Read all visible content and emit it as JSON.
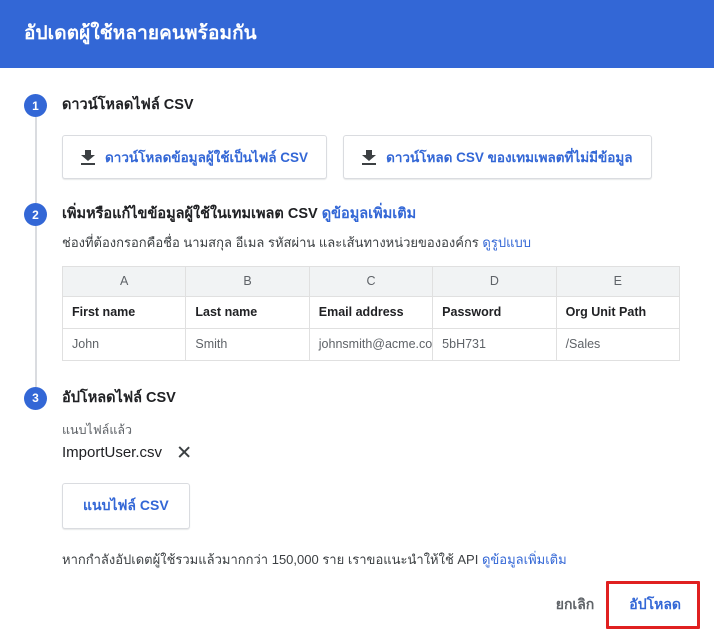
{
  "header": {
    "title": "อัปเดตผู้ใช้หลายคนพร้อมกัน",
    "bg_color": "#3367d6"
  },
  "steps": [
    {
      "number": "1",
      "heading": "ดาวน์โหลดไฟล์ CSV",
      "buttons": [
        {
          "label": "ดาวน์โหลดข้อมูลผู้ใช้เป็นไฟล์ CSV",
          "icon": "download-icon"
        },
        {
          "label": "ดาวน์โหลด CSV ของเทมเพลตที่ไม่มีข้อมูล",
          "icon": "download-icon"
        }
      ]
    },
    {
      "number": "2",
      "heading": "เพิ่มหรือแก้ไขข้อมูลผู้ใช้ในเทมเพลต CSV",
      "heading_link": "ดูข้อมูลเพิ่มเติม",
      "sub": "ช่องที่ต้องกรอกคือชื่อ นามสกุล อีเมล รหัสผ่าน และเส้นทางหน่วยขององค์กร",
      "sub_link": "ดูรูปแบบ"
    },
    {
      "number": "3",
      "heading": "อัปโหลดไฟล์ CSV",
      "attached_label": "แนบไฟล์แล้ว",
      "file_name": "ImportUser.csv",
      "remove_icon": "close-icon",
      "attach_button": "แนบไฟล์ CSV",
      "note": "หากกำลังอัปเดตผู้ใช้รวมแล้วมากกว่า 150,000 ราย เราขอแนะนำให้ใช้ API",
      "note_link": "ดูข้อมูลเพิ่มเติม"
    }
  ],
  "table": {
    "column_letters": [
      "A",
      "B",
      "C",
      "D",
      "E"
    ],
    "field_names": [
      "First name",
      "Last name",
      "Email address",
      "Password",
      "Org Unit Path"
    ],
    "sample_row": [
      "John",
      "Smith",
      "johnsmith@acme.com",
      "5bH731",
      "/Sales"
    ]
  },
  "footer": {
    "cancel_label": "ยกเลิก",
    "upload_label": "อัปโหลด",
    "highlight_color": "#e02020"
  }
}
